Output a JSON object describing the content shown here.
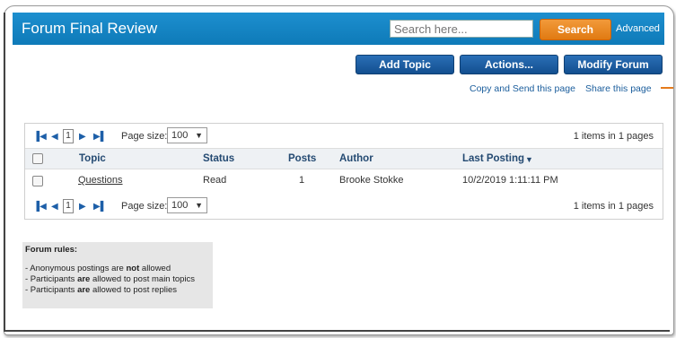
{
  "header": {
    "title": "Forum Final Review",
    "search_placeholder": "Search here...",
    "search_button": "Search",
    "advanced_link": "Advanced"
  },
  "toolbar": {
    "add_topic": "Add Topic",
    "actions": "Actions...",
    "modify_forum": "Modify Forum"
  },
  "links": {
    "copy_send": "Copy and Send this page",
    "share": "Share this page"
  },
  "pager": {
    "page": "1",
    "page_size_label": "Page size:",
    "page_size": "100",
    "count": "1 items in 1 pages"
  },
  "table": {
    "columns": [
      "Topic",
      "Status",
      "Posts",
      "Author",
      "Last Posting"
    ],
    "rows": [
      {
        "topic": "Questions",
        "status": "Read",
        "posts": "1",
        "author": "Brooke Stokke",
        "last_posting": "10/2/2019 1:11:11 PM"
      }
    ]
  },
  "rules": {
    "title": "Forum rules:",
    "line1": {
      "pre": "- Anonymous postings are ",
      "bold": "not",
      "post": " allowed"
    },
    "line2": {
      "pre": "- Participants ",
      "bold": "are",
      "post": " allowed to post main topics"
    },
    "line3": {
      "pre": "- Participants ",
      "bold": "are",
      "post": " allowed to post replies"
    }
  },
  "colors": {
    "header_blue": "#1587c8",
    "button_navy": "#1a5aa0",
    "search_orange": "#e8851d"
  }
}
